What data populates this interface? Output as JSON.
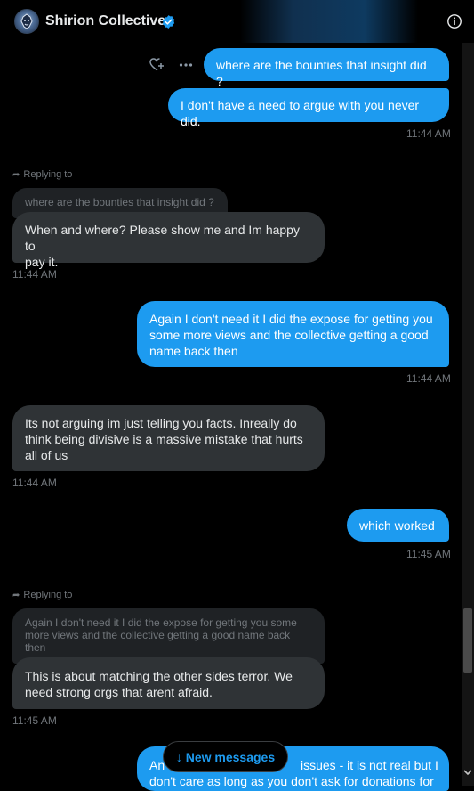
{
  "header": {
    "title": "Shirion Collective",
    "avatar_icon": "lion-logo",
    "verified_icon": "verified-badge-icon",
    "info_icon": "info-icon"
  },
  "colors": {
    "outgoing_bubble": "#1d9bf0",
    "incoming_bubble": "#2f3336",
    "background": "#000000",
    "timestamp": "#71767b"
  },
  "messages": [
    {
      "dir": "out",
      "text": "where are the bounties that insight did ?"
    },
    {
      "dir": "out",
      "text": "I don't have a need to argue with you never did."
    },
    {
      "time": "11:44 AM"
    },
    {
      "dir": "in",
      "replying_label": "Replying to",
      "quoted": "where are the bounties that insight did ?",
      "lines": [
        "When and where? Please show me and Im happy to",
        "pay it."
      ]
    },
    {
      "time": "11:44 AM"
    },
    {
      "dir": "out",
      "lines": [
        "Again I don't need it I did the expose for getting you",
        "some more views and the collective getting a good",
        "name back then"
      ]
    },
    {
      "time": "11:44 AM"
    },
    {
      "dir": "in",
      "lines": [
        "Its not arguing im just telling you facts. Inreally do",
        "think being divisive is a massive mistake that hurts",
        "all of us"
      ]
    },
    {
      "time": "11:44 AM"
    },
    {
      "dir": "out",
      "text": "which worked"
    },
    {
      "time": "11:45 AM"
    },
    {
      "dir": "in",
      "replying_label": "Replying to",
      "quoted_lines": [
        "Again I don't need it I did the expose for getting you some",
        "more views and the collective getting a good name back",
        "then"
      ],
      "lines": [
        "This is about matching the other sides terror. We",
        "need strong orgs that arent afraid."
      ]
    },
    {
      "time": "11:45 AM"
    },
    {
      "dir": "out",
      "partial_lines": [
        "An",
        "issues - it is not real but I",
        "don't care as long as you don't ask for donations for"
      ]
    }
  ],
  "new_messages_button": {
    "arrow": "↓",
    "label": "New messages"
  },
  "message_actions": {
    "react_icon": "add-reaction-icon",
    "more_icon": "more-dots-icon"
  },
  "scrollbar": {
    "position_fraction": 0.86
  }
}
